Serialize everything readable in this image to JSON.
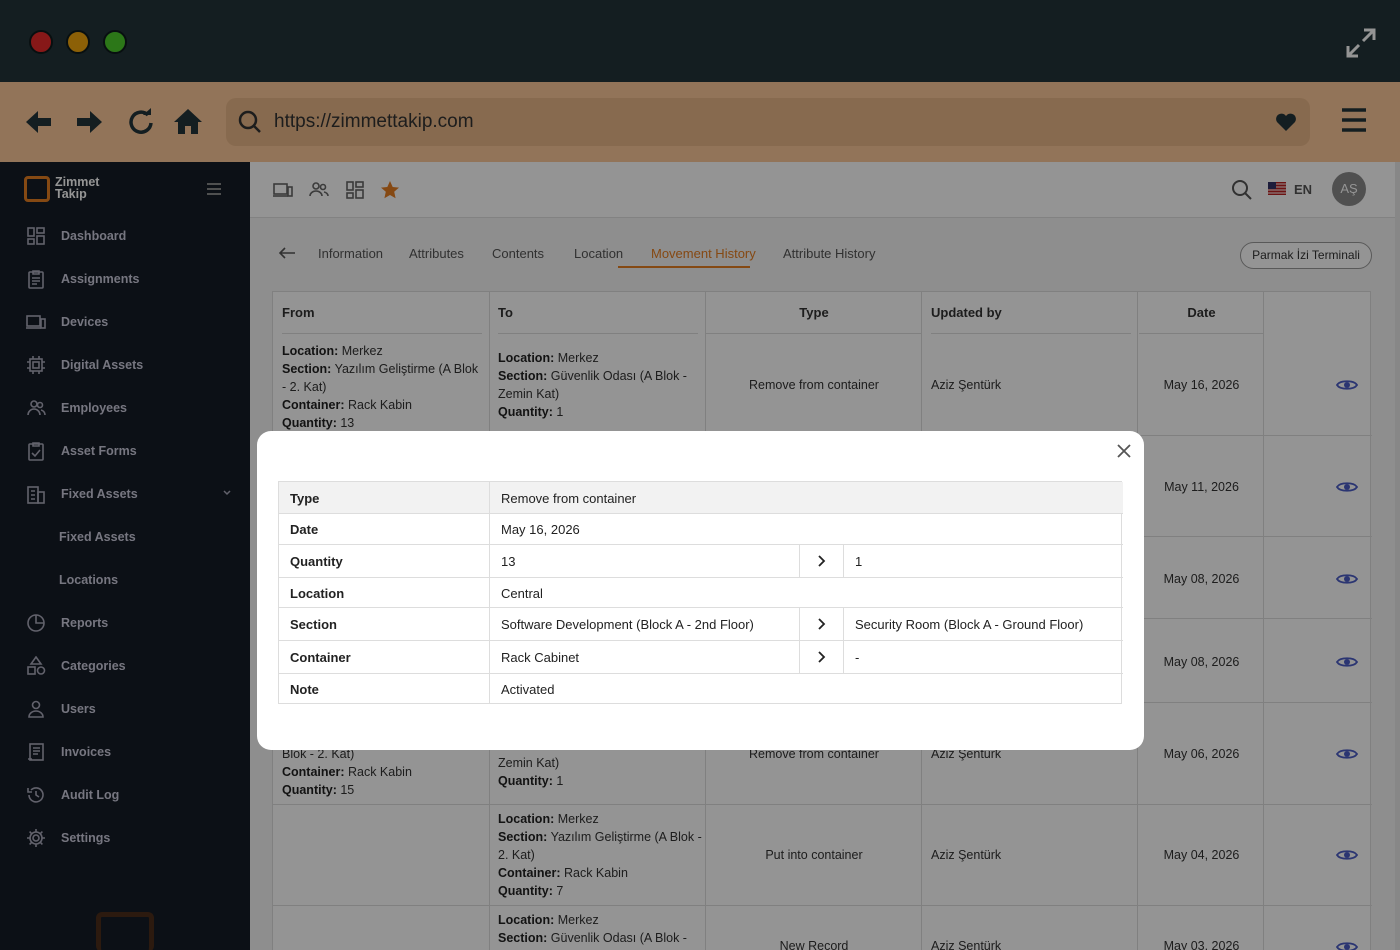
{
  "browser": {
    "url": "https://zimmettakip.com"
  },
  "app": {
    "logo_line1": "Zimmet",
    "logo_line2": "Takip",
    "language": "EN",
    "avatar": "AŞ"
  },
  "sidebar": {
    "items": [
      {
        "label": "Dashboard",
        "icon": "dashboard-icon"
      },
      {
        "label": "Assignments",
        "icon": "clipboard-icon"
      },
      {
        "label": "Devices",
        "icon": "devices-icon"
      },
      {
        "label": "Digital Assets",
        "icon": "chip-icon"
      },
      {
        "label": "Employees",
        "icon": "users-icon"
      },
      {
        "label": "Asset Forms",
        "icon": "checklist-icon"
      },
      {
        "label": "Fixed Assets",
        "icon": "building-icon"
      },
      {
        "label": "Fixed Assets",
        "icon": ""
      },
      {
        "label": "Locations",
        "icon": ""
      },
      {
        "label": "Reports",
        "icon": "pie-chart-icon"
      },
      {
        "label": "Categories",
        "icon": "shapes-icon"
      },
      {
        "label": "Users",
        "icon": "user-icon"
      },
      {
        "label": "Invoices",
        "icon": "invoice-icon"
      },
      {
        "label": "Audit Log",
        "icon": "history-icon"
      },
      {
        "label": "Settings",
        "icon": "gear-icon"
      }
    ]
  },
  "tabs": [
    "Information",
    "Attributes",
    "Contents",
    "Location",
    "Movement History",
    "Attribute History"
  ],
  "terminal_button": "Parmak İzi Terminali",
  "table": {
    "headers": [
      "From",
      "To",
      "Type",
      "Updated by",
      "Date"
    ],
    "rows": [
      {
        "from": [
          [
            "Location:",
            "Merkez"
          ],
          [
            "Section:",
            "Yazılım Geliştirme (A Blok - 2. Kat)"
          ],
          [
            "Container:",
            "Rack Kabin"
          ],
          [
            "Quantity:",
            "13"
          ]
        ],
        "to": [
          [
            "Location:",
            "Merkez"
          ],
          [
            "Section:",
            "Güvenlik Odası (A Blok - Zemin Kat)"
          ],
          [
            "Quantity:",
            "1"
          ]
        ],
        "type": "Remove from container",
        "updated_by": "Aziz Şentürk",
        "date": "May 16, 2026"
      },
      {
        "from": [],
        "to": [],
        "type": "",
        "updated_by": "",
        "date": "May 11, 2026"
      },
      {
        "from": [],
        "to": [],
        "type": "",
        "updated_by": "",
        "date": "May 08, 2026"
      },
      {
        "from": [],
        "to": [],
        "type": "",
        "updated_by": "",
        "date": "May 08, 2026"
      },
      {
        "from_partial": [
          [
            "",
            "Blok - 2. Kat)"
          ],
          [
            "Container:",
            "Rack Kabin"
          ],
          [
            "Quantity:",
            "15"
          ]
        ],
        "to_partial": [
          [
            "",
            "Zemin Kat)"
          ],
          [
            "Quantity:",
            "1"
          ]
        ],
        "type": "Remove from container",
        "updated_by": "Aziz Şentürk",
        "date": "May 06, 2026"
      },
      {
        "from": [],
        "to": [
          [
            "Location:",
            "Merkez"
          ],
          [
            "Section:",
            "Yazılım Geliştirme (A Blok - 2. Kat)"
          ],
          [
            "Container:",
            "Rack Kabin"
          ],
          [
            "Quantity:",
            "7"
          ]
        ],
        "type": "Put into container",
        "updated_by": "Aziz Şentürk",
        "date": "May 04, 2026"
      },
      {
        "from": [],
        "to": [
          [
            "Location:",
            "Merkez"
          ],
          [
            "Section:",
            "Güvenlik Odası (A Blok -"
          ]
        ],
        "type": "New Record",
        "updated_by": "Aziz Şentürk",
        "date": "May 03, 2026"
      }
    ]
  },
  "modal": {
    "rows": [
      {
        "key": "Type",
        "value": "Remove from container"
      },
      {
        "key": "Date",
        "value": "May 16, 2026"
      },
      {
        "key": "Quantity",
        "value": "13",
        "to": "1"
      },
      {
        "key": "Location",
        "value": "Central"
      },
      {
        "key": "Section",
        "value": "Software Development (Block A - 2nd Floor)",
        "to": "Security Room (Block A - Ground Floor)"
      },
      {
        "key": "Container",
        "value": "Rack Cabinet",
        "to": "-"
      },
      {
        "key": "Note",
        "value": "Activated"
      }
    ]
  }
}
